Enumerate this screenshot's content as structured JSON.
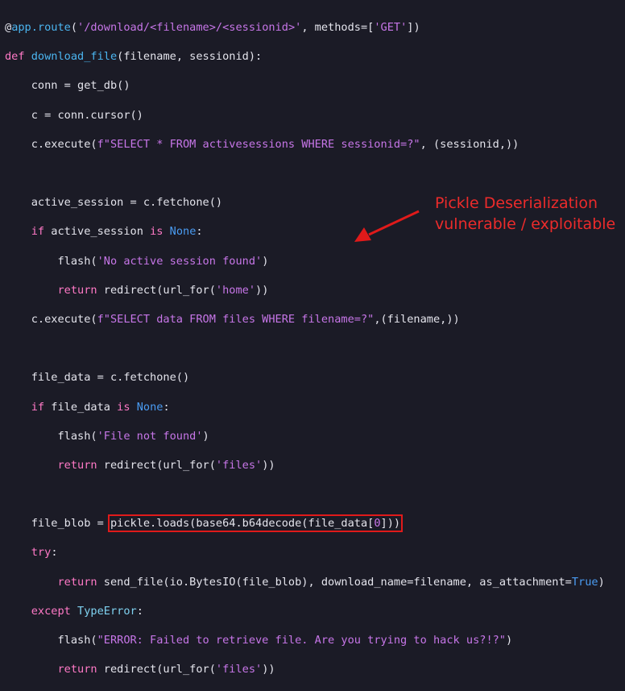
{
  "code": {
    "line1": {
      "at": "@",
      "decorator": "app.route",
      "open": "(",
      "route": "'/download/<filename>/<sessionid>'",
      "mid": ", methods=[",
      "method": "'GET'",
      "close": "])"
    },
    "line2": {
      "kw": "def",
      "name": "download_file",
      "rest": "(filename, sessionid):"
    },
    "line3": {
      "text": "    conn = get_db()"
    },
    "line4": {
      "text": "    c = conn.cursor()"
    },
    "line5": {
      "pre": "    c.execute(",
      "fstr": "f\"SELECT * FROM activesessions WHERE sessionid=?\"",
      "post": ", (sessionid,))"
    },
    "line6": {
      "text": ""
    },
    "line7": {
      "text": "    active_session = c.fetchone()"
    },
    "line8": {
      "indent": "    ",
      "kw": "if",
      "mid": " active_session ",
      "kw2": "is",
      "sp": " ",
      "const": "None",
      "end": ":"
    },
    "line9": {
      "pre": "        flash(",
      "str": "'No active session found'",
      "post": ")"
    },
    "line10": {
      "indent": "        ",
      "kw": "return",
      "pre": " redirect(url_for(",
      "str": "'home'",
      "post": "))"
    },
    "line11": {
      "pre": "    c.execute(",
      "fstr": "f\"SELECT data FROM files WHERE filename=?\"",
      "post": ",(filename,))"
    },
    "line12": {
      "text": ""
    },
    "line13": {
      "text": "    file_data = c.fetchone()"
    },
    "line14": {
      "indent": "    ",
      "kw": "if",
      "mid": " file_data ",
      "kw2": "is",
      "sp": " ",
      "const": "None",
      "end": ":"
    },
    "line15": {
      "pre": "        flash(",
      "str": "'File not found'",
      "post": ")"
    },
    "line16": {
      "indent": "        ",
      "kw": "return",
      "pre": " redirect(url_for(",
      "str": "'files'",
      "post": "))"
    },
    "line17": {
      "text": ""
    },
    "line18": {
      "pre": "    file_blob = ",
      "hl_pre": "pickle.loads(base64.b64decode(file_data[",
      "hl_num": "0",
      "hl_post": "]))"
    },
    "line19": {
      "indent": "    ",
      "kw": "try",
      "end": ":"
    },
    "line20": {
      "indent": "        ",
      "kw": "return",
      "pre": " send_file(io.BytesIO(file_blob), download_name=filename, as_attachment=",
      "bool": "True",
      "post": ")"
    },
    "line21": {
      "indent": "    ",
      "kw": "except",
      "sp": " ",
      "cls": "TypeError",
      "end": ":"
    },
    "line22": {
      "pre": "        flash(",
      "str": "\"ERROR: Failed to retrieve file. Are you trying to hack us?!?\"",
      "post": ")"
    },
    "line23": {
      "indent": "        ",
      "kw": "return",
      "pre": " redirect(url_for(",
      "str": "'files'",
      "post": "))"
    }
  },
  "annotation": {
    "line1": "Pickle Deserialization",
    "line2": "vulnerable / exploitable"
  },
  "colors": {
    "background": "#1b1b26",
    "keyword": "#ff79c6",
    "string": "#c776e8",
    "function": "#4bb5f0",
    "highlight": "#e01a1a"
  }
}
